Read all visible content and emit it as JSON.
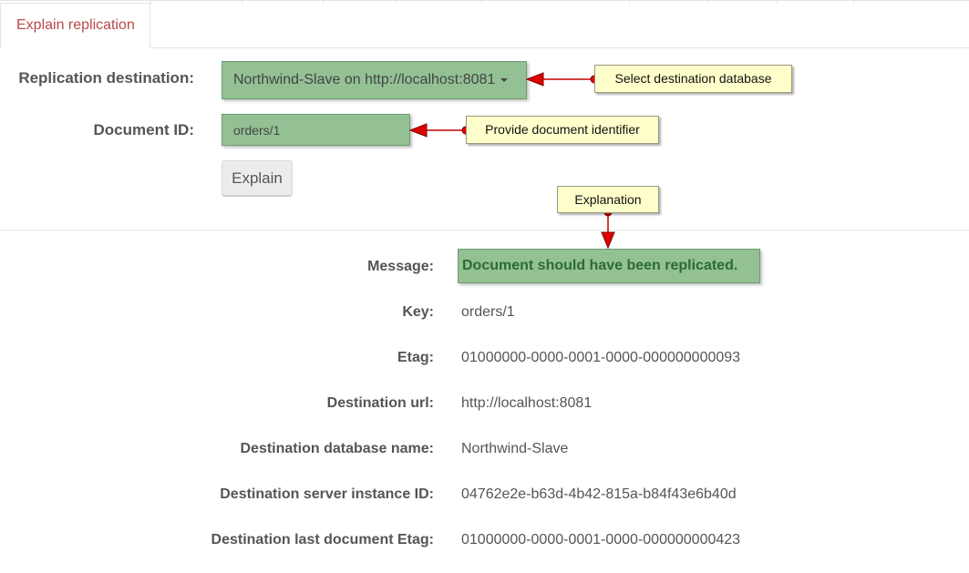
{
  "tabs": {
    "active_label": "Explain replication"
  },
  "form": {
    "destination_label": "Replication destination:",
    "destination_value": "Northwind-Slave on http://localhost:8081",
    "document_id_label": "Document ID:",
    "document_id_value": "orders/1",
    "explain_button": "Explain"
  },
  "callouts": {
    "select_destination": "Select destination database",
    "provide_id": "Provide document identifier",
    "explanation": "Explanation"
  },
  "details": {
    "message": {
      "label": "Message:",
      "value": "Document should have been replicated."
    },
    "key": {
      "label": "Key:",
      "value": "orders/1"
    },
    "etag": {
      "label": "Etag:",
      "value": "01000000-0000-0001-0000-000000000093"
    },
    "destination_url": {
      "label": "Destination url:",
      "value": "http://localhost:8081"
    },
    "destination_db": {
      "label": "Destination database name:",
      "value": "Northwind-Slave"
    },
    "server_instance": {
      "label": "Destination server instance ID:",
      "value": "04762e2e-b63d-4b42-815a-b84f43e6b40d"
    },
    "last_etag": {
      "label": "Destination last document Etag:",
      "value": "01000000-0000-0001-0000-000000000423"
    }
  },
  "colors": {
    "accent_tab_text": "#b94a48",
    "field_green": "#93c194",
    "message_text": "#2e6b2f",
    "callout_bg": "#ffffcc",
    "arrow_red": "#e00000"
  }
}
